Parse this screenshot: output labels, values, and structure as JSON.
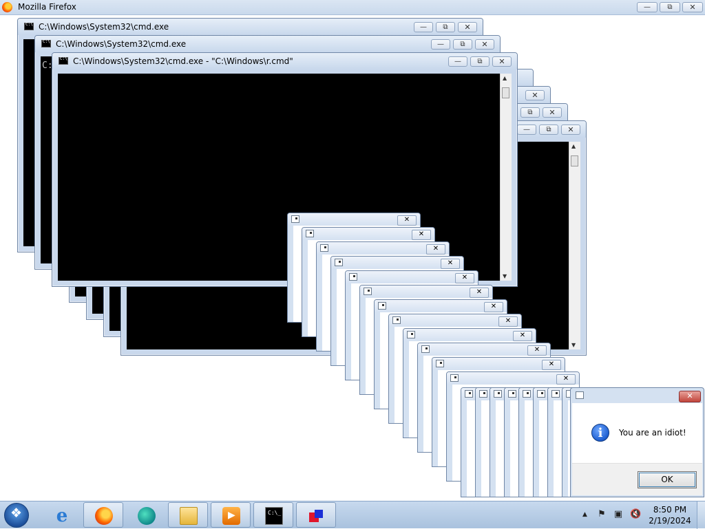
{
  "browser": {
    "title": "Mozilla Firefox"
  },
  "window_controls": {
    "minimize": "—",
    "maximize": "⧉",
    "close": "✕"
  },
  "cmd_windows": [
    {
      "title": "C:\\Windows\\System32\\cmd.exe"
    },
    {
      "title": "C:\\Windows\\System32\\cmd.exe",
      "prompt": "C:"
    },
    {
      "title": "C:\\Windows\\System32\\cmd.exe - \"C:\\Windows\\r.cmd\""
    }
  ],
  "dialog": {
    "message": "You are an idiot!",
    "ok_label": "OK",
    "icon": "information-icon",
    "close_label": "✕"
  },
  "taskbar": {
    "pinned": [
      "internet-explorer-icon",
      "firefox-icon",
      "edge-icon",
      "file-explorer-icon",
      "media-player-icon",
      "cmd-icon",
      "app-cube-icon"
    ],
    "time": "8:50 PM",
    "date": "2/19/2024"
  }
}
